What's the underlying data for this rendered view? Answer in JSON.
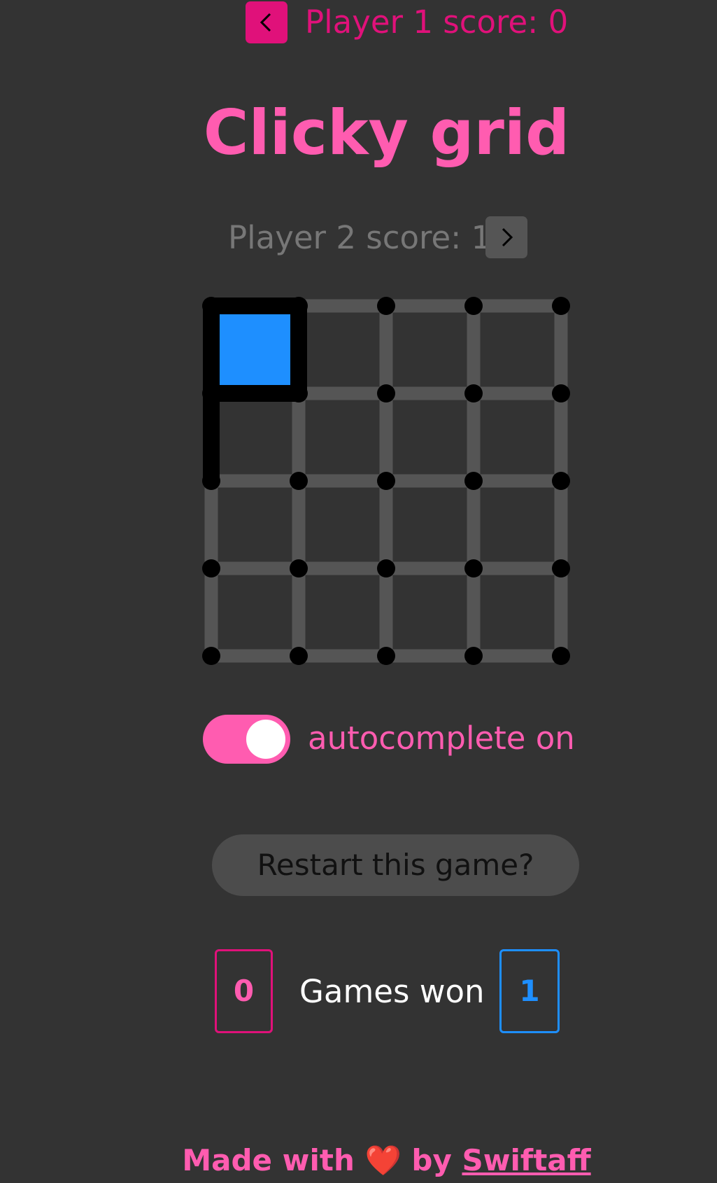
{
  "game": {
    "title": "Clicky grid",
    "player1_label": "Player 1 score: 0",
    "player2_label": "Player 2 score: 1",
    "autocomplete_label": "autocomplete on",
    "autocomplete_on": true,
    "restart_label": "Restart this game?",
    "games_won_label": "Games won",
    "player1_wins": "0",
    "player2_wins": "1",
    "footer_prefix": "Made with",
    "footer_heart": "❤️",
    "footer_by": "by",
    "footer_link": "Swiftaff",
    "icons": {
      "prev": "chevron-left-icon",
      "next": "chevron-right-icon",
      "heart": "heart-icon"
    },
    "colors": {
      "background": "#333333",
      "player1": "#e0117a",
      "accent": "#ff5cb0",
      "player2": "#1e8fff",
      "grid_line": "#555555",
      "claimed_line": "#000000",
      "dot": "#000000"
    }
  },
  "grid": {
    "rows": 4,
    "cols": 4,
    "claimed_horizontal": [
      [
        0,
        0
      ],
      [
        1,
        0
      ]
    ],
    "claimed_vertical": [
      [
        0,
        0
      ],
      [
        0,
        1
      ],
      [
        1,
        0
      ]
    ],
    "filled_boxes": [
      {
        "row": 0,
        "col": 0,
        "color": "#1e8fff"
      }
    ]
  }
}
